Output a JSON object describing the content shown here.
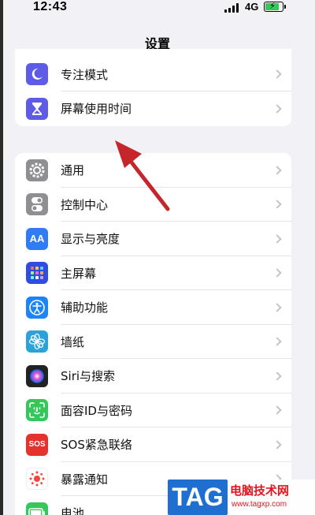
{
  "status_bar": {
    "time": "12:43",
    "network": "4G"
  },
  "nav": {
    "title": "设置"
  },
  "group1": {
    "items": [
      {
        "label": "专注模式",
        "icon": "moon-icon",
        "color": "#5e5ce6"
      },
      {
        "label": "屏幕使用时间",
        "icon": "hourglass-icon",
        "color": "#5e5ce6"
      }
    ]
  },
  "group2": {
    "items": [
      {
        "label": "通用",
        "icon": "gear-icon",
        "color": "#8e8e93"
      },
      {
        "label": "控制中心",
        "icon": "toggle-icon",
        "color": "#8e8e93"
      },
      {
        "label": "显示与亮度",
        "icon": "text-size-icon",
        "color": "#2f7cf6"
      },
      {
        "label": "主屏幕",
        "icon": "home-grid-icon",
        "color": "#2f4de0"
      },
      {
        "label": "辅助功能",
        "icon": "accessibility-icon",
        "color": "#1c84f6"
      },
      {
        "label": "墙纸",
        "icon": "flower-icon",
        "color": "#2aa2dc"
      },
      {
        "label": "Siri与搜索",
        "icon": "siri-icon",
        "color": "#222222"
      },
      {
        "label": "面容ID与密码",
        "icon": "face-id-icon",
        "color": "#34c759"
      },
      {
        "label": "SOS紧急联络",
        "icon": "sos-icon",
        "color": "#e5322d",
        "icon_text": "SOS"
      },
      {
        "label": "暴露通知",
        "icon": "exposure-icon",
        "color": "#ffffff"
      },
      {
        "label": "电池",
        "icon": "battery-icon",
        "color": "#34c759"
      }
    ]
  },
  "annotation": {
    "arrow_color": "#c4262b"
  },
  "watermark": {
    "tag": "TAG",
    "site": "电脑技术网",
    "url": "www.tagxp.com"
  }
}
